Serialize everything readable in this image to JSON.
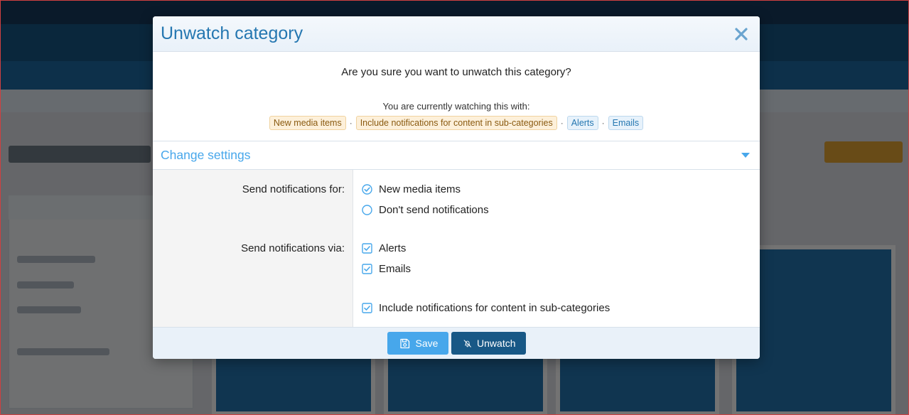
{
  "modal": {
    "title": "Unwatch category",
    "close_icon": "close-icon",
    "question": "Are you sure you want to unwatch this category?",
    "watching_intro": "You are currently watching this with:",
    "watch_tags": [
      {
        "label": "New media items",
        "style": "orange"
      },
      {
        "label": "Include notifications for content in sub-categories",
        "style": "orange"
      },
      {
        "label": "Alerts",
        "style": "blue"
      },
      {
        "label": "Emails",
        "style": "blue"
      }
    ],
    "tag_separator": "·",
    "change_settings": {
      "title": "Change settings",
      "expand_icon": "caret-down-icon"
    },
    "form": {
      "notify_for": {
        "label": "Send notifications for:",
        "options": [
          {
            "label": "New media items",
            "selected": true,
            "icon": "radio-checked-icon"
          },
          {
            "label": "Don't send notifications",
            "selected": false,
            "icon": "radio-empty-icon"
          }
        ]
      },
      "notify_via": {
        "label": "Send notifications via:",
        "options": [
          {
            "label": "Alerts",
            "checked": true,
            "icon": "checkbox-checked-icon"
          },
          {
            "label": "Emails",
            "checked": true,
            "icon": "checkbox-checked-icon"
          }
        ]
      },
      "include_sub": {
        "label": "Include notifications for content in sub-categories",
        "checked": true,
        "icon": "checkbox-checked-icon"
      }
    },
    "buttons": {
      "save": {
        "label": "Save",
        "icon": "save-icon"
      },
      "unwatch": {
        "label": "Unwatch",
        "icon": "bell-slash-icon"
      }
    }
  },
  "colors": {
    "accent": "#2577b1",
    "accent_light": "#47a7eb",
    "primary_dark": "#185886",
    "tag_orange_bg": "#fdf0da",
    "tag_blue_bg": "#e7f2fb"
  }
}
